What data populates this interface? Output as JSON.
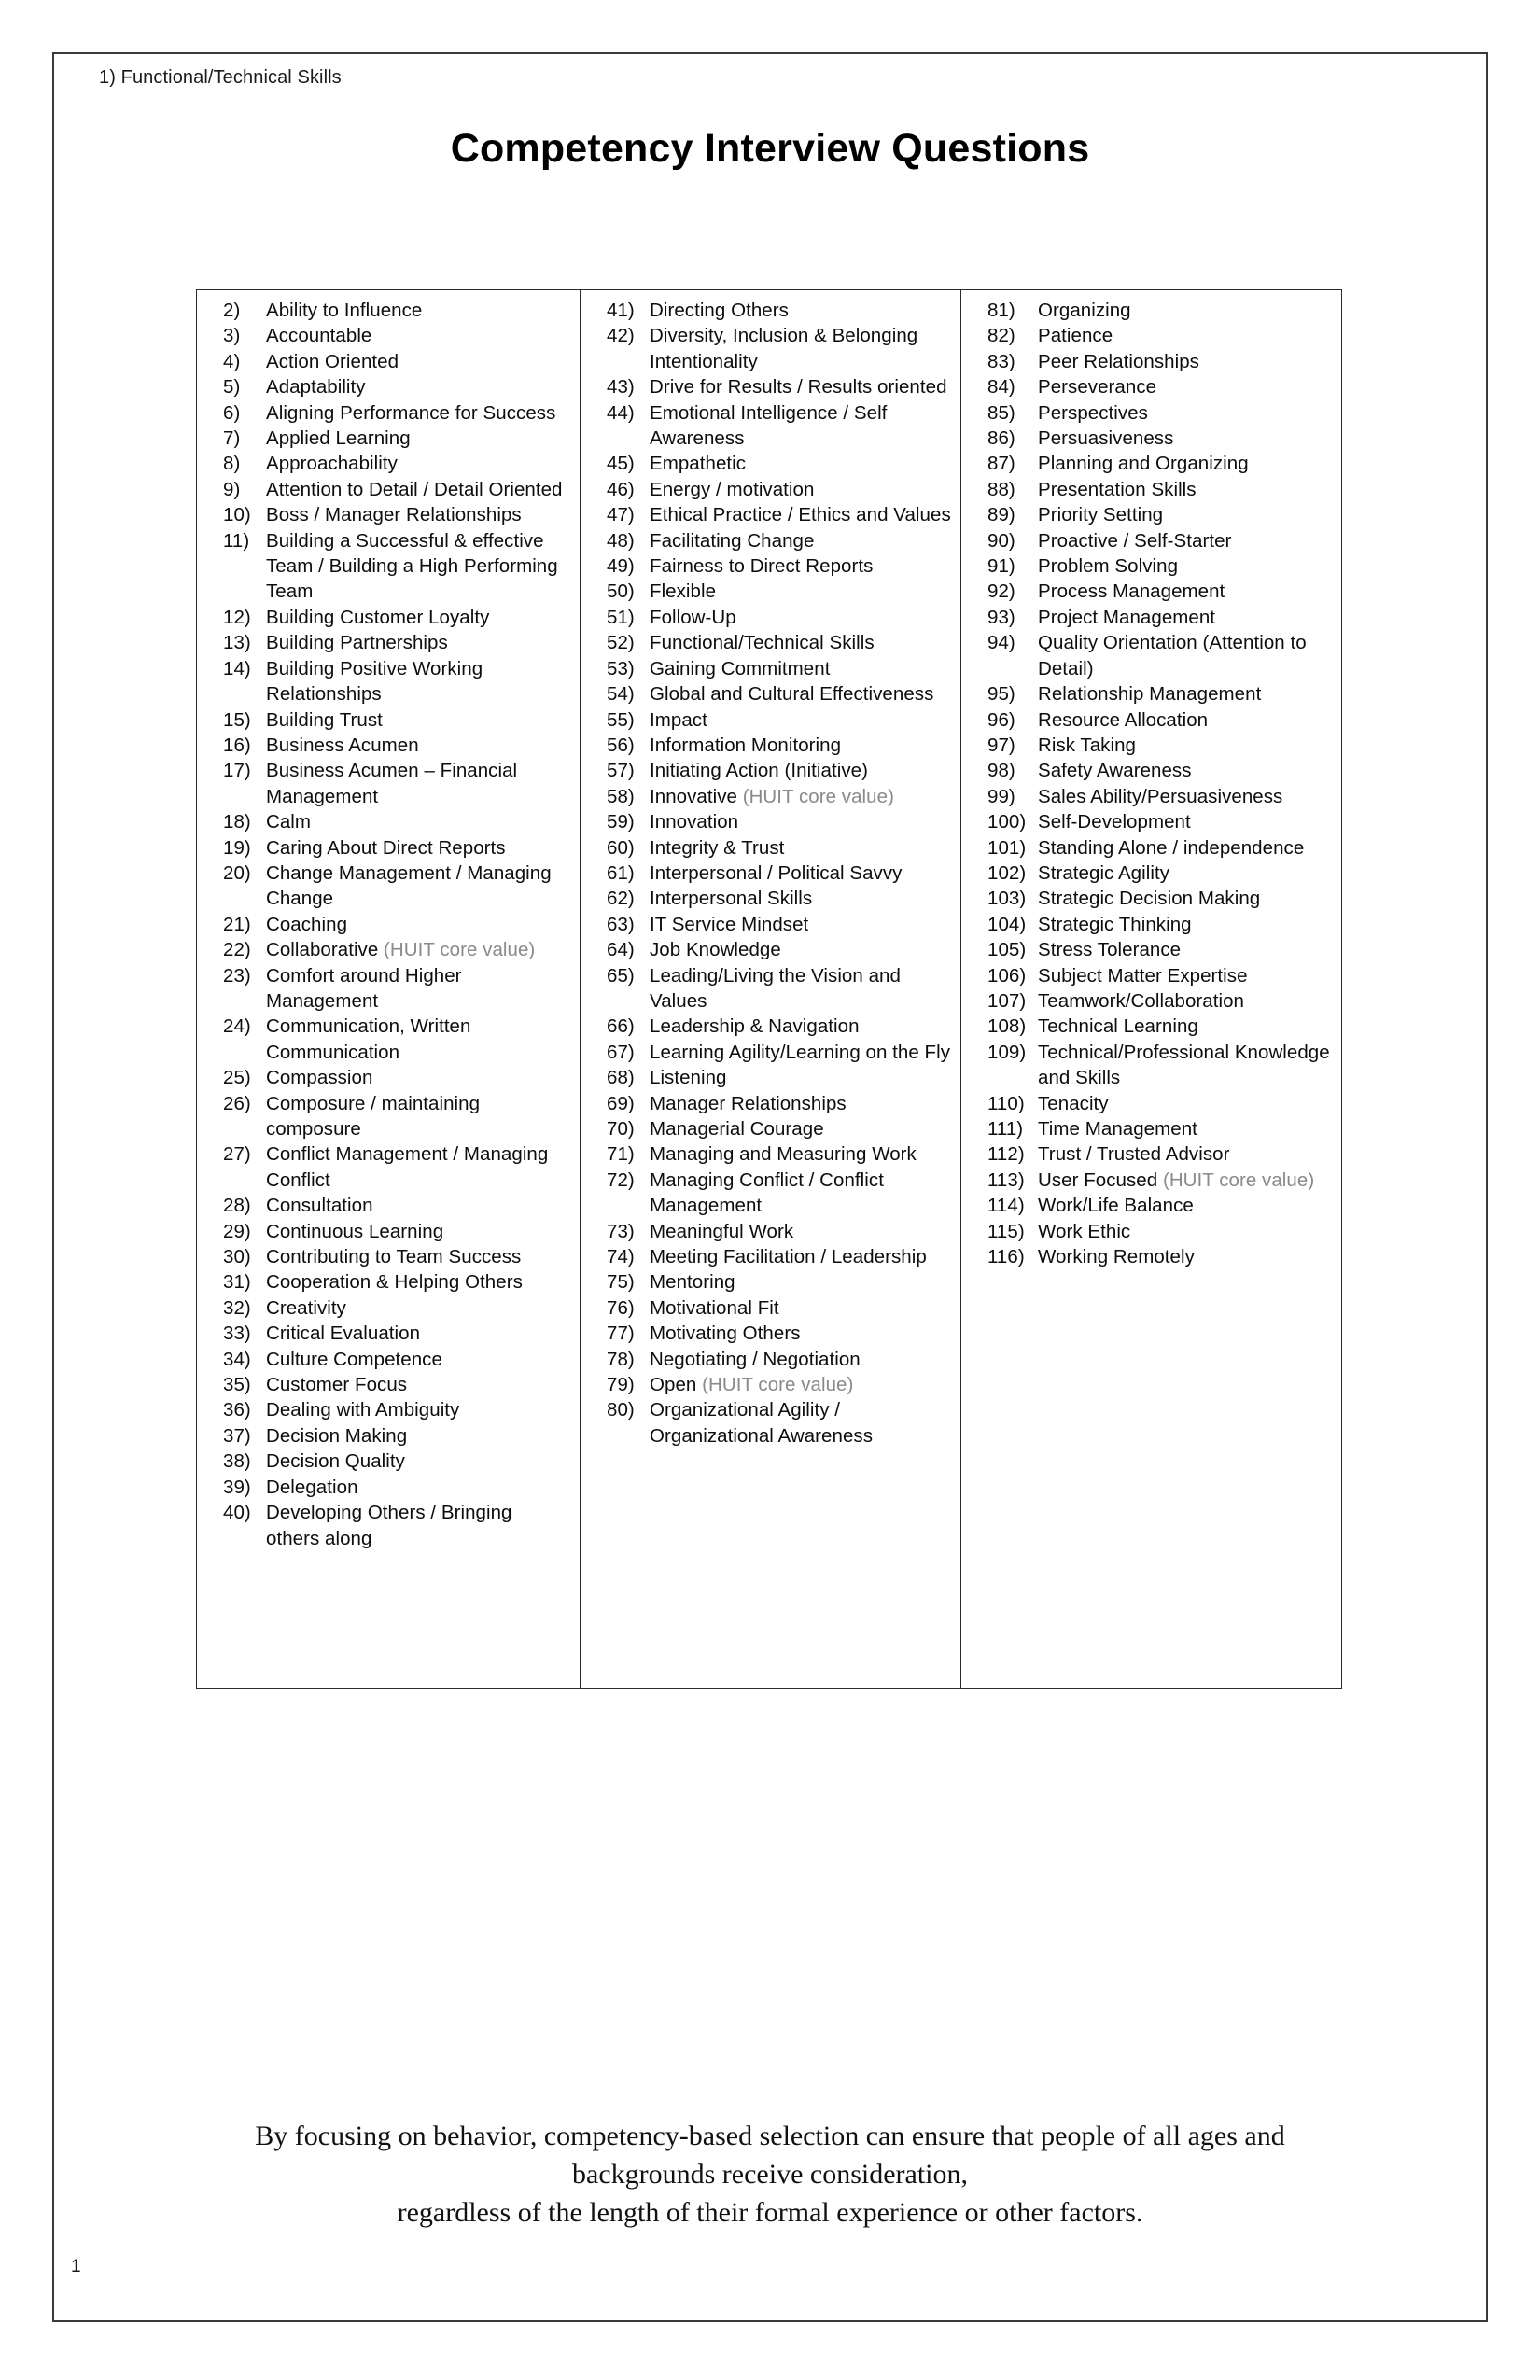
{
  "header": {
    "slug": "1) Functional/Technical Skills",
    "title": "Competency Interview Questions"
  },
  "table": {
    "columns": [
      {
        "id": "column-1",
        "items": [
          {
            "num": "2)",
            "text": "Ability to Influence"
          },
          {
            "num": "3)",
            "text": "Accountable"
          },
          {
            "num": "4)",
            "text": "Action Oriented"
          },
          {
            "num": "5)",
            "text": "Adaptability"
          },
          {
            "num": "6)",
            "text": "Aligning Performance for Success"
          },
          {
            "num": "7)",
            "text": "Applied Learning"
          },
          {
            "num": "8)",
            "text": "Approachability"
          },
          {
            "num": "9)",
            "text": "Attention to Detail / Detail Oriented"
          },
          {
            "num": "10)",
            "text": "Boss / Manager Relationships"
          },
          {
            "num": "11)",
            "text": "Building a Successful & effective Team / Building a High Performing Team"
          },
          {
            "num": "12)",
            "text": "Building Customer Loyalty"
          },
          {
            "num": "13)",
            "text": "Building Partnerships"
          },
          {
            "num": "14)",
            "text": "Building Positive Working Relationships"
          },
          {
            "num": "15)",
            "text": "Building Trust"
          },
          {
            "num": "16)",
            "text": "Business Acumen"
          },
          {
            "num": "17)",
            "text": "Business Acumen – Financial Management"
          },
          {
            "num": "18)",
            "text": "Calm"
          },
          {
            "num": "19)",
            "text": "Caring About Direct Reports"
          },
          {
            "num": "20)",
            "text": "Change Management / Managing Change"
          },
          {
            "num": "21)",
            "text": "Coaching"
          },
          {
            "num": "22)",
            "text": "Collaborative ",
            "note": "(HUIT core value)"
          },
          {
            "num": "23)",
            "text": "Comfort around Higher Management"
          },
          {
            "num": "24)",
            "text": "Communication, Written Communication"
          },
          {
            "num": "25)",
            "text": "Compassion"
          },
          {
            "num": "26)",
            "text": "Composure / maintaining composure"
          },
          {
            "num": "27)",
            "text": "Conflict Management / Managing Conflict"
          },
          {
            "num": "28)",
            "text": "Consultation"
          },
          {
            "num": "29)",
            "text": "Continuous Learning"
          },
          {
            "num": "30)",
            "text": "Contributing to Team Success"
          },
          {
            "num": "31)",
            "text": "Cooperation & Helping Others"
          },
          {
            "num": "32)",
            "text": "Creativity"
          },
          {
            "num": "33)",
            "text": "Critical Evaluation"
          },
          {
            "num": "34)",
            "text": "Culture Competence"
          },
          {
            "num": "35)",
            "text": "Customer Focus"
          },
          {
            "num": "36)",
            "text": "Dealing with Ambiguity"
          },
          {
            "num": "37)",
            "text": "Decision Making"
          },
          {
            "num": "38)",
            "text": "Decision Quality"
          },
          {
            "num": "39)",
            "text": "Delegation"
          },
          {
            "num": "40)",
            "text": "Developing Others / Bringing others along"
          }
        ]
      },
      {
        "id": "column-2",
        "items": [
          {
            "num": "41)",
            "text": "Directing Others"
          },
          {
            "num": "42)",
            "text": "Diversity, Inclusion & Belonging Intentionality"
          },
          {
            "num": "43)",
            "text": "Drive for Results / Results oriented"
          },
          {
            "num": "44)",
            "text": "Emotional Intelligence / Self Awareness"
          },
          {
            "num": "45)",
            "text": "Empathetic"
          },
          {
            "num": "46)",
            "text": "Energy / motivation"
          },
          {
            "num": "47)",
            "text": "Ethical Practice / Ethics and Values"
          },
          {
            "num": "48)",
            "text": "Facilitating Change"
          },
          {
            "num": "49)",
            "text": "Fairness to Direct Reports"
          },
          {
            "num": "50)",
            "text": "Flexible"
          },
          {
            "num": "51)",
            "text": "Follow-Up"
          },
          {
            "num": "52)",
            "text": "Functional/Technical Skills"
          },
          {
            "num": "53)",
            "text": "Gaining Commitment"
          },
          {
            "num": "54)",
            "text": "Global and Cultural Effectiveness"
          },
          {
            "num": "55)",
            "text": "Impact"
          },
          {
            "num": "56)",
            "text": "Information Monitoring"
          },
          {
            "num": "57)",
            "text": "Initiating Action (Initiative)"
          },
          {
            "num": "58)",
            "text": "Innovative ",
            "note": "(HUIT core value)"
          },
          {
            "num": "59)",
            "text": "Innovation"
          },
          {
            "num": "60)",
            "text": "Integrity & Trust"
          },
          {
            "num": "61)",
            "text": "Interpersonal / Political Savvy"
          },
          {
            "num": "62)",
            "text": "Interpersonal Skills"
          },
          {
            "num": "63)",
            "text": "IT Service Mindset"
          },
          {
            "num": "64)",
            "text": "Job Knowledge"
          },
          {
            "num": "65)",
            "text": "Leading/Living the Vision and Values"
          },
          {
            "num": "66)",
            "text": "Leadership & Navigation"
          },
          {
            "num": "67)",
            "text": "Learning Agility/Learning on the Fly"
          },
          {
            "num": "68)",
            "text": "Listening"
          },
          {
            "num": "69)",
            "text": "Manager Relationships"
          },
          {
            "num": "70)",
            "text": "Managerial Courage"
          },
          {
            "num": "71)",
            "text": "Managing and Measuring Work"
          },
          {
            "num": "72)",
            "text": "Managing Conflict / Conflict Management"
          },
          {
            "num": "73)",
            "text": "Meaningful Work"
          },
          {
            "num": "74)",
            "text": "Meeting Facilitation / Leadership"
          },
          {
            "num": "75)",
            "text": "Mentoring"
          },
          {
            "num": "76)",
            "text": "Motivational Fit"
          },
          {
            "num": "77)",
            "text": "Motivating Others"
          },
          {
            "num": "78)",
            "text": "Negotiating / Negotiation"
          },
          {
            "num": "79)",
            "text": "Open ",
            "note": "(HUIT core value)"
          },
          {
            "num": "80)",
            "text": "Organizational Agility / Organizational Awareness"
          }
        ]
      },
      {
        "id": "column-3",
        "items": [
          {
            "num": "81)",
            "text": "Organizing"
          },
          {
            "num": "82)",
            "text": "Patience"
          },
          {
            "num": "83)",
            "text": "Peer Relationships"
          },
          {
            "num": "84)",
            "text": "Perseverance"
          },
          {
            "num": "85)",
            "text": "Perspectives"
          },
          {
            "num": "86)",
            "text": "Persuasiveness"
          },
          {
            "num": "87)",
            "text": "Planning and Organizing"
          },
          {
            "num": "88)",
            "text": "Presentation Skills"
          },
          {
            "num": "89)",
            "text": "Priority Setting"
          },
          {
            "num": "90)",
            "text": "Proactive / Self-Starter"
          },
          {
            "num": "91)",
            "text": "Problem Solving"
          },
          {
            "num": "92)",
            "text": "Process Management"
          },
          {
            "num": "93)",
            "text": "Project Management"
          },
          {
            "num": "94)",
            "text": "Quality Orientation (Attention to Detail)"
          },
          {
            "num": "95)",
            "text": "Relationship Management"
          },
          {
            "num": "96)",
            "text": "Resource Allocation"
          },
          {
            "num": "97)",
            "text": "Risk Taking"
          },
          {
            "num": "98)",
            "text": "Safety Awareness"
          },
          {
            "num": "99)",
            "text": "Sales Ability/Persuasiveness"
          },
          {
            "num": "100)",
            "text": "Self-Development"
          },
          {
            "num": "101)",
            "text": "Standing Alone / independence"
          },
          {
            "num": "102)",
            "text": "Strategic Agility"
          },
          {
            "num": "103)",
            "text": "Strategic Decision Making"
          },
          {
            "num": "104)",
            "text": "Strategic Thinking"
          },
          {
            "num": "105)",
            "text": "Stress Tolerance"
          },
          {
            "num": "106)",
            "text": "Subject Matter Expertise"
          },
          {
            "num": "107)",
            "text": "Teamwork/Collaboration"
          },
          {
            "num": "108)",
            "text": "Technical Learning"
          },
          {
            "num": "109)",
            "text": "Technical/Professional Knowledge and Skills"
          },
          {
            "num": "110)",
            "text": "Tenacity"
          },
          {
            "num": "111)",
            "text": "Time Management"
          },
          {
            "num": "112)",
            "text": "Trust / Trusted Advisor"
          },
          {
            "num": "113)",
            "text": "User Focused ",
            "note": "(HUIT core value)"
          },
          {
            "num": "114)",
            "text": "Work/Life Balance"
          },
          {
            "num": "115)",
            "text": "Work Ethic"
          },
          {
            "num": "116)",
            "text": "Working Remotely"
          }
        ]
      }
    ]
  },
  "footer": {
    "quote_lines": [
      "By focusing on behavior, competency-based selection can ensure that people of all ages and",
      "backgrounds receive consideration,",
      "regardless of the length of their formal experience or other factors."
    ],
    "page_number": "1"
  },
  "colors": {
    "text": "#0d0d0d",
    "note": "#8a8a8a",
    "border": "#2b2b2b"
  }
}
